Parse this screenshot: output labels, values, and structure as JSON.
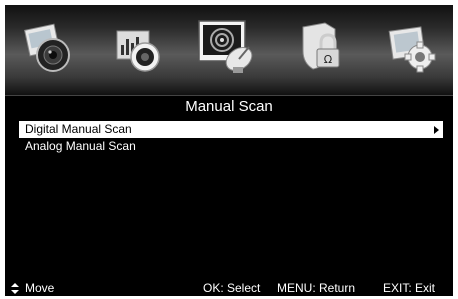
{
  "menu": {
    "icons": [
      {
        "name": "picture-icon",
        "selected": false
      },
      {
        "name": "sound-icon",
        "selected": false
      },
      {
        "name": "channel-scan-icon",
        "selected": true
      },
      {
        "name": "lock-icon",
        "selected": false
      },
      {
        "name": "settings-icon",
        "selected": false
      }
    ]
  },
  "page": {
    "title": "Manual Scan"
  },
  "list": {
    "items": [
      {
        "label": "Digital Manual Scan",
        "highlighted": true
      },
      {
        "label": "Analog Manual Scan",
        "highlighted": false
      }
    ]
  },
  "footer": {
    "move": "Move",
    "ok": "OK: Select",
    "menu": "MENU: Return",
    "exit": "EXIT: Exit"
  },
  "colors": {
    "highlight": "#ffffff",
    "background": "#000000",
    "text": "#ffffff"
  }
}
